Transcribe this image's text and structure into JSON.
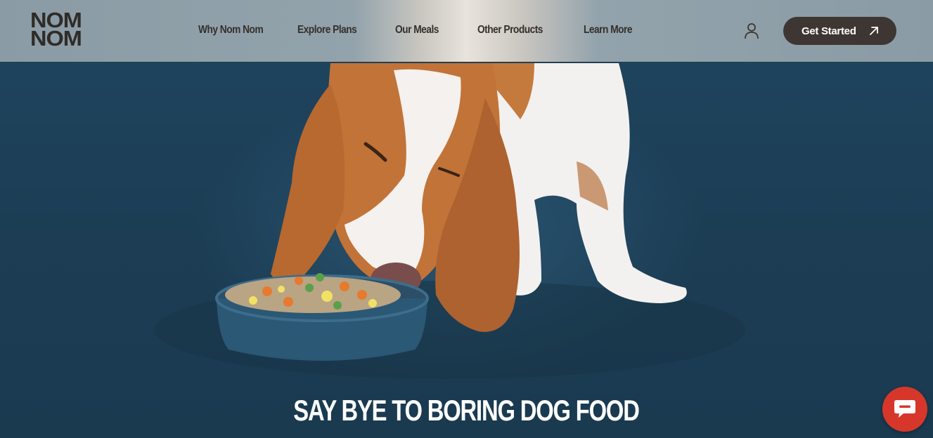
{
  "brand": {
    "logo_line1": "NOM",
    "logo_line2": "NOM"
  },
  "nav": {
    "items": [
      {
        "label": "Why Nom Nom"
      },
      {
        "label": "Explore Plans"
      },
      {
        "label": "Our Meals"
      },
      {
        "label": "Other Products"
      },
      {
        "label": "Learn More"
      }
    ]
  },
  "header": {
    "cta_label": "Get Started"
  },
  "hero": {
    "headline": "SAY BYE TO BORING DOG FOOD"
  },
  "colors": {
    "cta": "#3d3632",
    "chat": "#d7372b",
    "hero_bg": "#1e3f56"
  },
  "icons": {
    "account": "user-icon",
    "cta_arrow": "arrow-up-right-icon",
    "chat": "chat-bubble-icon"
  }
}
